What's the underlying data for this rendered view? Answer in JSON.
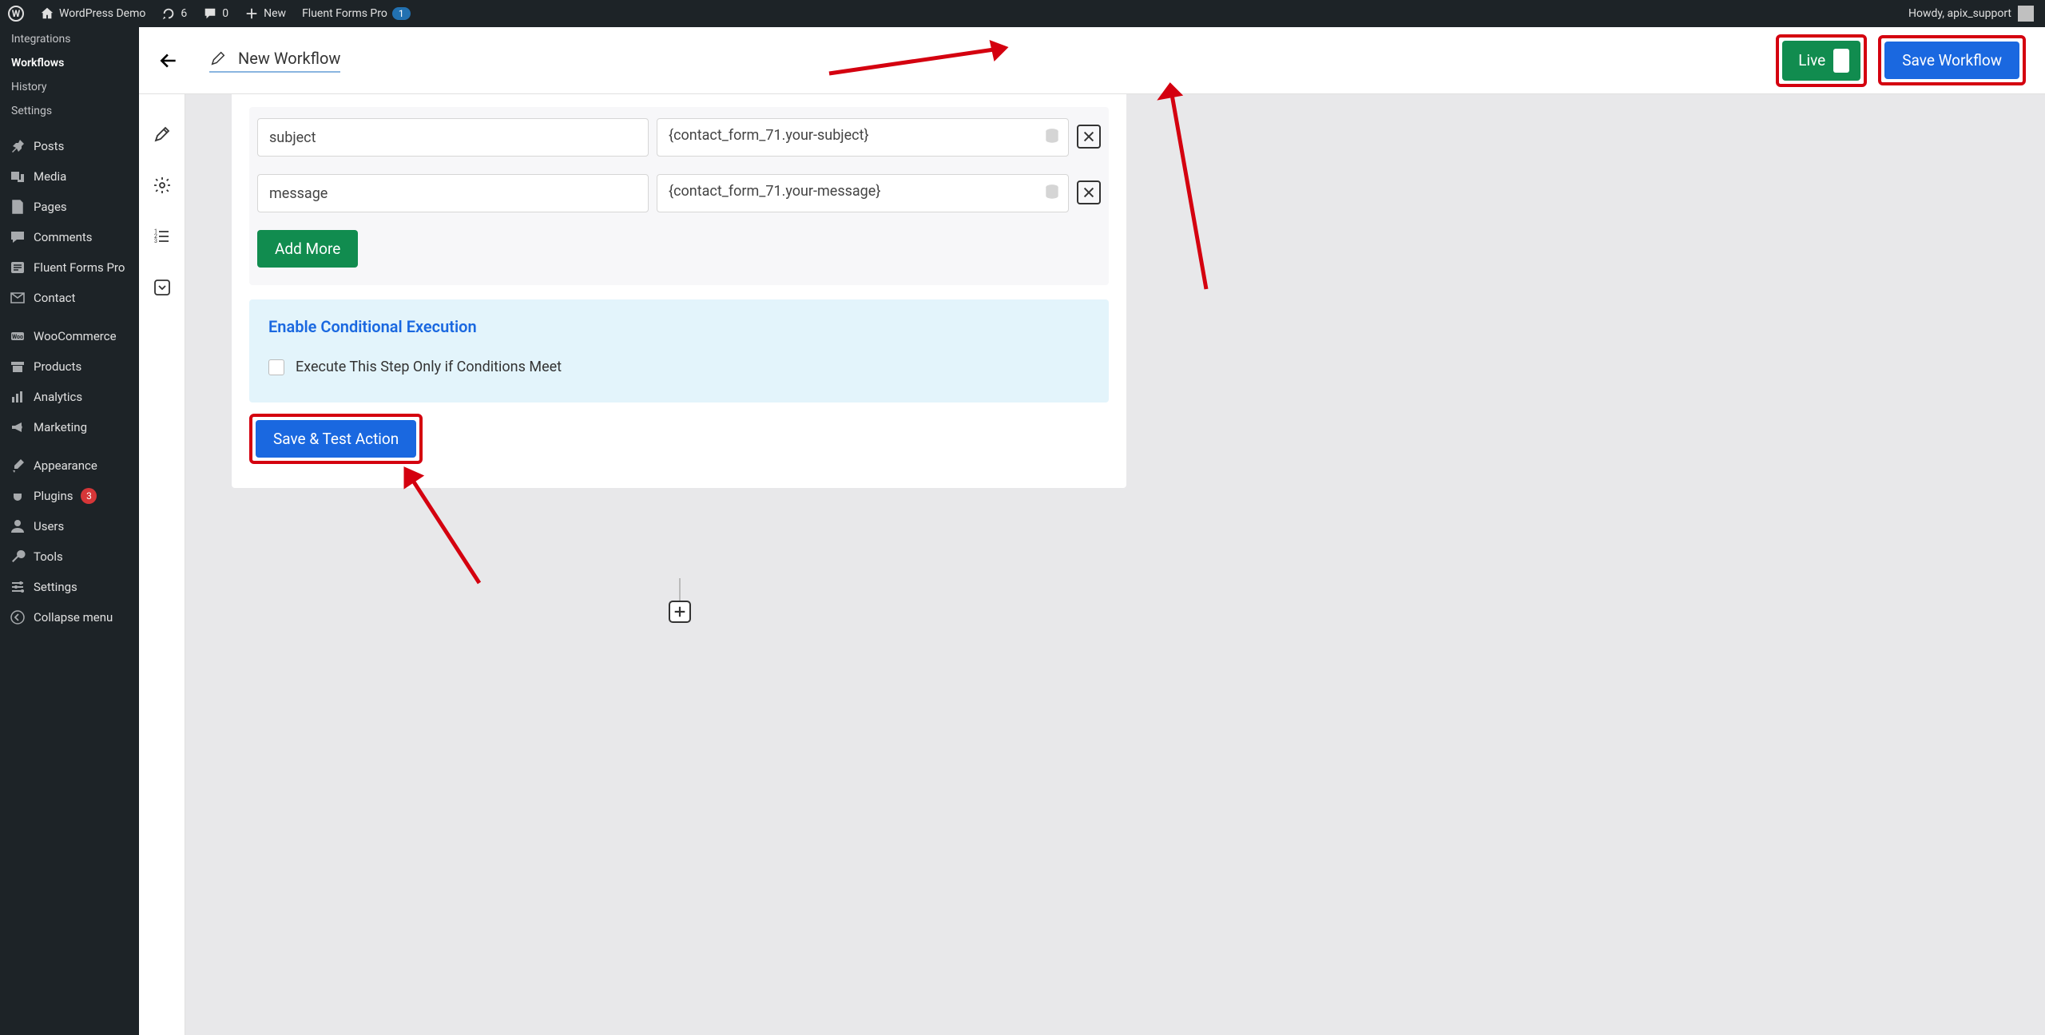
{
  "adminbar": {
    "site": "WordPress Demo",
    "updates": "6",
    "comments": "0",
    "new": "New",
    "fluent": "Fluent Forms Pro",
    "fluent_badge": "1",
    "howdy": "Howdy, apix_support"
  },
  "sidemenu": {
    "integrations": "Integrations",
    "workflows": "Workflows",
    "history": "History",
    "settings": "Settings",
    "posts": "Posts",
    "media": "Media",
    "pages": "Pages",
    "comments": "Comments",
    "fluent": "Fluent Forms Pro",
    "contact": "Contact",
    "woo": "WooCommerce",
    "products": "Products",
    "analytics": "Analytics",
    "marketing": "Marketing",
    "appearance": "Appearance",
    "plugins": "Plugins",
    "plugins_badge": "3",
    "users": "Users",
    "tools": "Tools",
    "admin_settings": "Settings",
    "collapse": "Collapse menu"
  },
  "topbar": {
    "title": "New Workflow",
    "live": "Live",
    "save": "Save Workflow"
  },
  "form": {
    "rows": [
      {
        "key": "subject",
        "value": "{contact_form_71.your-subject}"
      },
      {
        "key": "message",
        "value": "{contact_form_71.your-message}"
      }
    ],
    "add_more": "Add More",
    "cond_title": "Enable Conditional Execution",
    "cond_label": "Execute This Step Only if Conditions Meet",
    "save_test": "Save & Test Action"
  }
}
